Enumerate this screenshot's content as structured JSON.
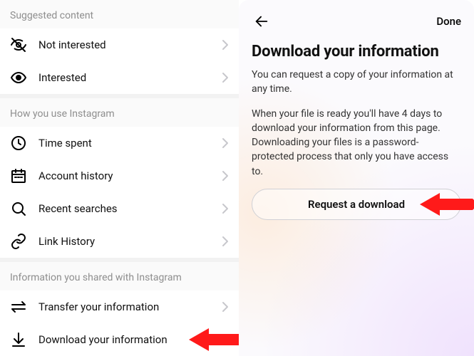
{
  "left": {
    "sections": [
      {
        "header": "Suggested content",
        "items": [
          {
            "key": "not-interested",
            "label": "Not interested",
            "icon": "eye-off-icon"
          },
          {
            "key": "interested",
            "label": "Interested",
            "icon": "eye-icon"
          }
        ]
      },
      {
        "header": "How you use Instagram",
        "items": [
          {
            "key": "time-spent",
            "label": "Time spent",
            "icon": "clock-icon"
          },
          {
            "key": "account-history",
            "label": "Account history",
            "icon": "calendar-icon"
          },
          {
            "key": "recent-searches",
            "label": "Recent searches",
            "icon": "search-icon"
          },
          {
            "key": "link-history",
            "label": "Link History",
            "icon": "link-icon"
          }
        ]
      },
      {
        "header": "Information you shared with Instagram",
        "items": [
          {
            "key": "transfer-info",
            "label": "Transfer your information",
            "icon": "transfer-icon"
          },
          {
            "key": "download-info",
            "label": "Download your information",
            "icon": "download-icon"
          }
        ]
      }
    ]
  },
  "right": {
    "done_label": "Done",
    "title": "Download your information",
    "desc1": "You can request a copy of your information at any time.",
    "desc2": "When your file is ready you'll have 4 days to download your information from this page. Downloading your files is a password-protected process that only you have access to.",
    "request_label": "Request a download"
  }
}
